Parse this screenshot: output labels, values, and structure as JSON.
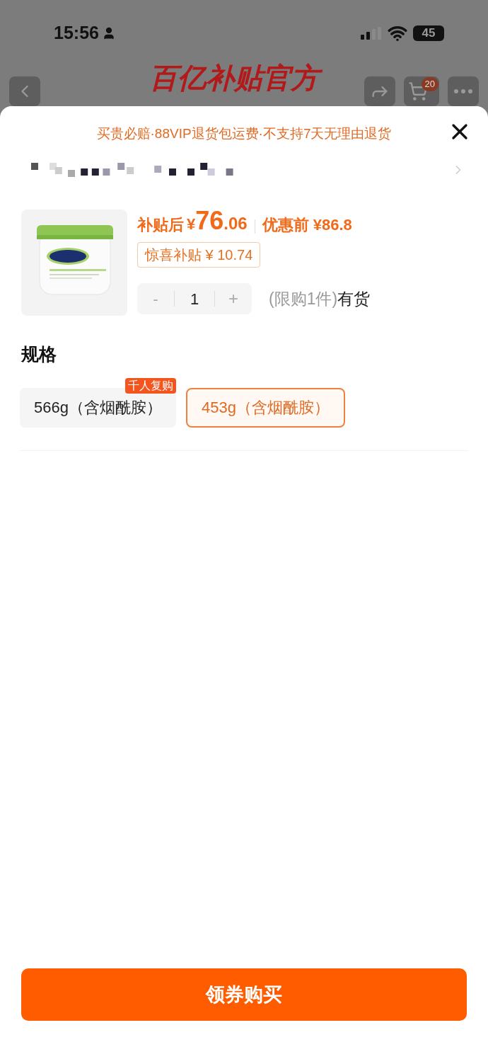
{
  "status_bar": {
    "time": "15:56",
    "battery": "45"
  },
  "background_page": {
    "title": "百亿补贴官方",
    "cart_badge": "20"
  },
  "sheet": {
    "guarantee": "买贵必赔·88VIP退货包运费·不支持7天无理由退货",
    "price": {
      "after_label": "补贴后",
      "currency": "¥",
      "after_int": "76",
      "after_dec": ".06",
      "before_label": "优惠前",
      "before": "¥86.8"
    },
    "subsidy": "惊喜补贴 ¥ 10.74",
    "quantity": {
      "minus": "-",
      "value": "1",
      "plus": "+",
      "disabled_minus": true,
      "disabled_plus": true
    },
    "limit": "(限购1件)",
    "stock": "有货",
    "spec_title": "规格",
    "options": [
      {
        "label": "566g（含烟酰胺）",
        "badge": "千人复购",
        "selected": false
      },
      {
        "label": "453g（含烟酰胺）",
        "selected": true
      }
    ],
    "buy_button": "领券购买"
  }
}
